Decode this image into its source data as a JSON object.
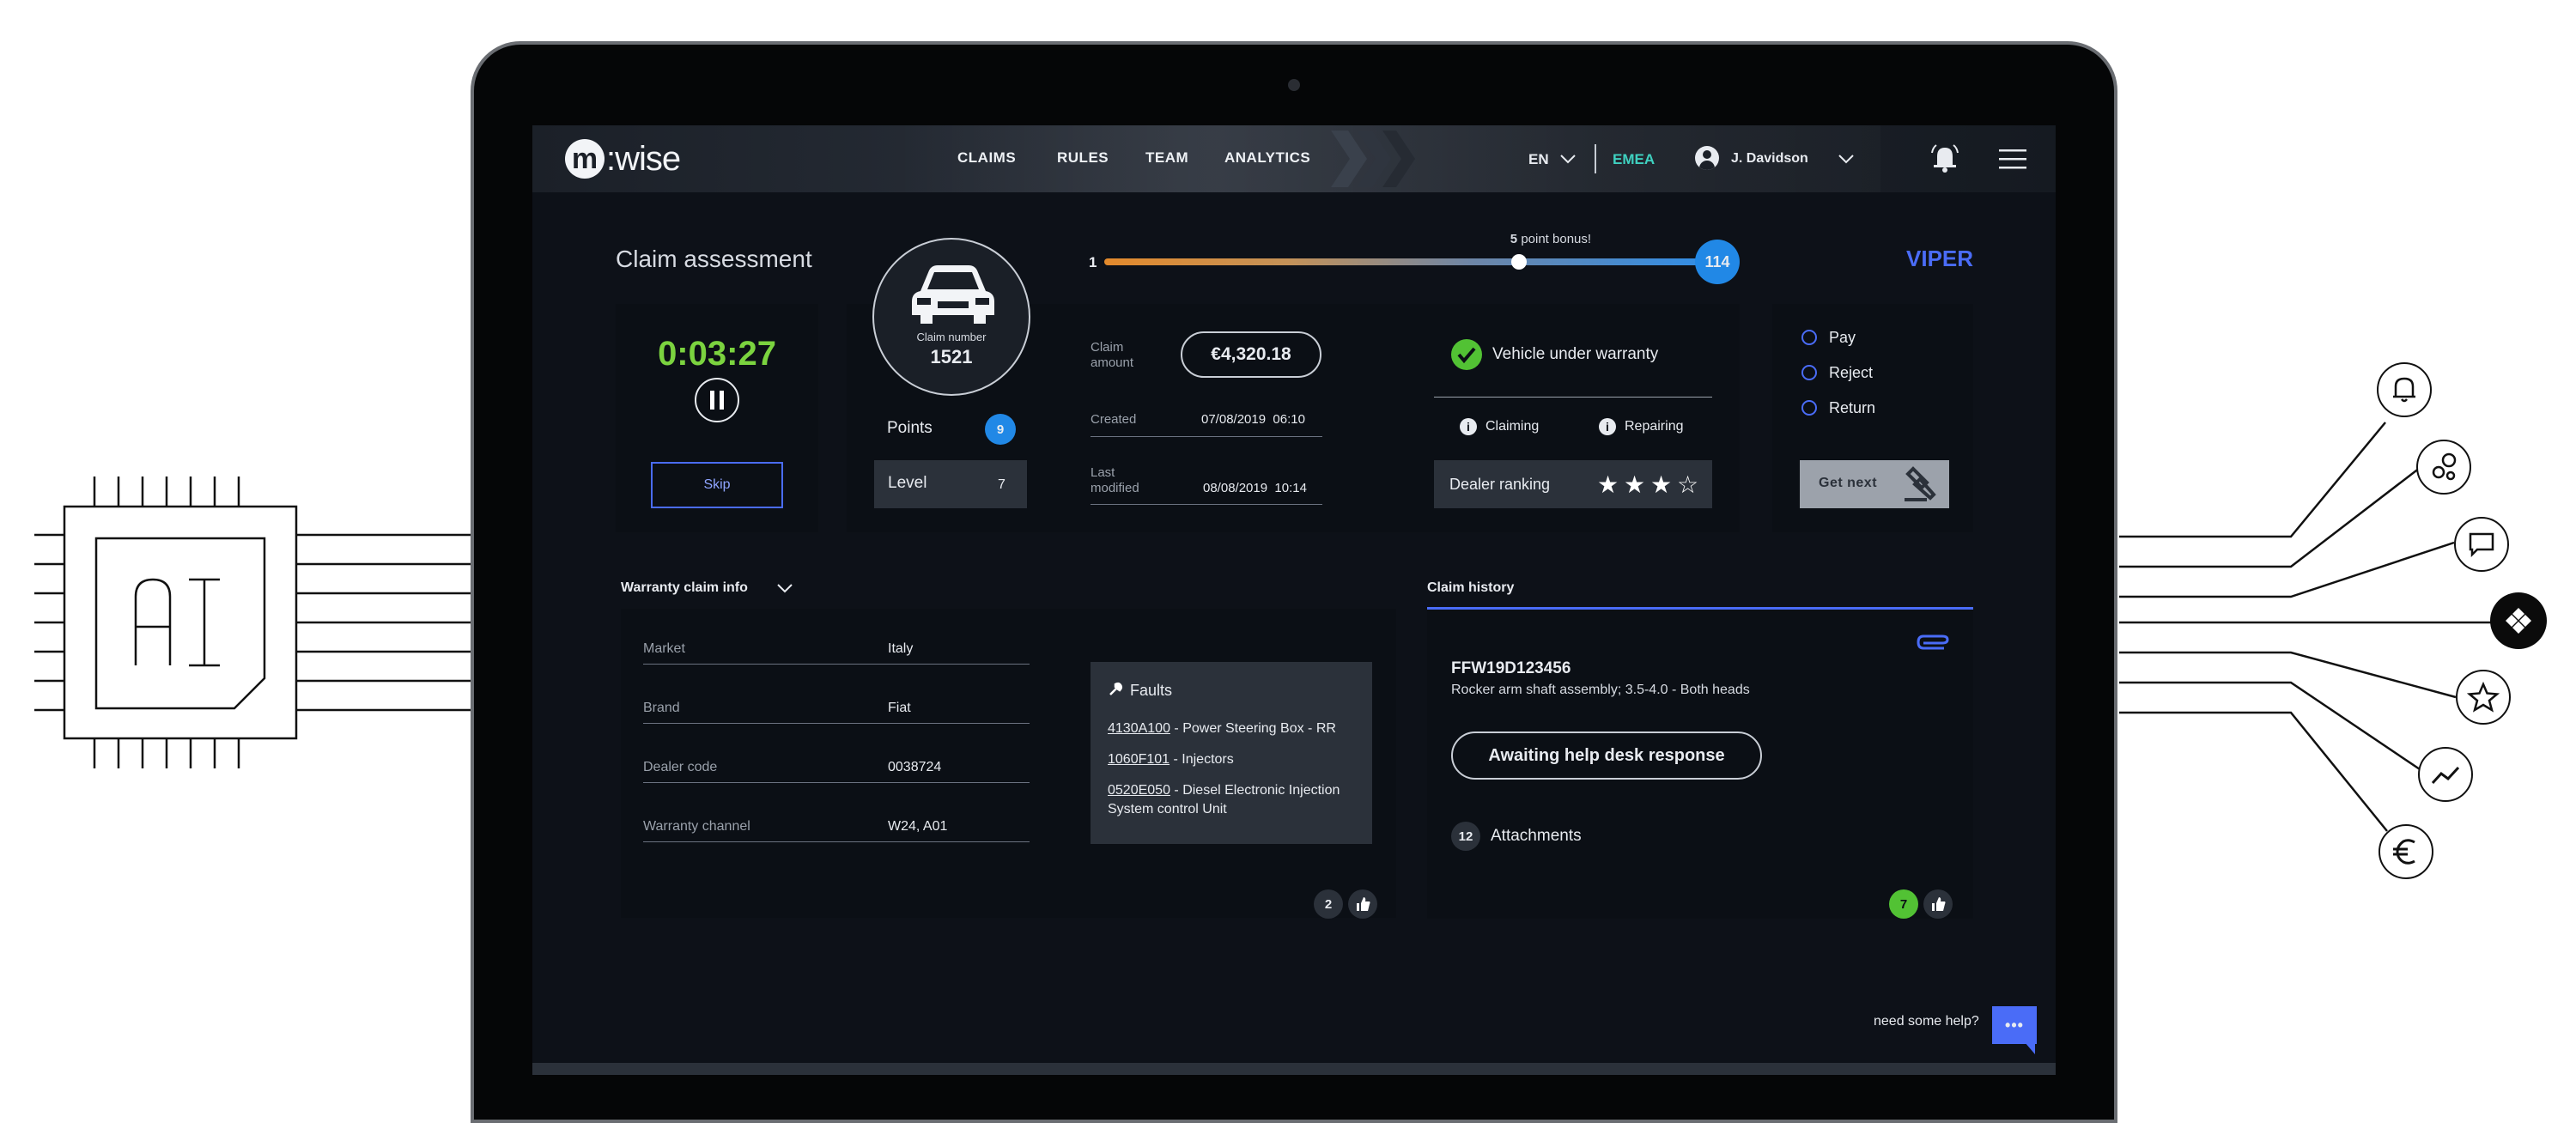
{
  "brand": {
    "logo_letter": "m",
    "logo_rest": ":wise"
  },
  "nav": {
    "links": [
      "CLAIMS",
      "RULES",
      "TEAM",
      "ANALYTICS"
    ],
    "language": "EN",
    "region": "EMEA",
    "user": "J. Davidson"
  },
  "assessment": {
    "title": "Claim assessment",
    "claim_number_label": "Claim number",
    "claim_number": "1521",
    "progress": {
      "start": "1",
      "end": "114",
      "bonus_value": "5",
      "bonus_text": "point bonus!",
      "marker_fraction": 0.68
    },
    "tag": "VIPER"
  },
  "timer": {
    "value": "0:03:27",
    "skip_label": "Skip"
  },
  "points": {
    "label": "Points",
    "value": "9",
    "level_label": "Level",
    "level_value": "7"
  },
  "claim": {
    "amount_label": "Claim amount",
    "amount_line1": "Claim",
    "amount_line2": "amount",
    "amount": "€4,320.18",
    "created_label": "Created",
    "created_value": "07/08/2019  06:10",
    "modified_line1": "Last",
    "modified_line2": "modified",
    "modified_value": "08/08/2019  10:14"
  },
  "warranty": {
    "status": "Vehicle under warranty",
    "claiming": "Claiming",
    "repairing": "Repairing",
    "dealer_ranking_label": "Dealer ranking",
    "dealer_rating": 3,
    "dealer_rating_max": 4
  },
  "decision": {
    "options": [
      "Pay",
      "Reject",
      "Return"
    ],
    "get_next_label": "Get next"
  },
  "claim_info": {
    "title": "Warranty claim info",
    "fields": [
      {
        "label": "Market",
        "value": "Italy"
      },
      {
        "label": "Brand",
        "value": "Fiat"
      },
      {
        "label": "Dealer code",
        "value": "0038724"
      },
      {
        "label": "Warranty channel",
        "value": "W24, A01"
      }
    ],
    "faults_title": "Faults",
    "faults": [
      {
        "code": "4130A100",
        "desc": " - Power Steering Box - RR"
      },
      {
        "code": "1060F101",
        "desc": " - Injectors"
      },
      {
        "code": "0520E050",
        "desc": " - Diesel Electronic Injection"
      },
      {
        "code": "",
        "desc": "System control Unit"
      }
    ],
    "likes": "2"
  },
  "history": {
    "title": "Claim history",
    "claim_id": "FFW19D123456",
    "description": "Rocker arm shaft assembly; 3.5-4.0 - Both heads",
    "status_button": "Awaiting help desk response",
    "attachments_count": "12",
    "attachments_label": "Attachments",
    "likes": "7"
  },
  "help": {
    "text": "need some help?",
    "icon_text": "•••"
  },
  "side": {
    "chip_label": "AI"
  },
  "colors": {
    "accent_blue": "#4a6cf7",
    "timer_green": "#7bd33f",
    "badge_blue": "#2188e6",
    "viper": "#4a6cf7"
  }
}
